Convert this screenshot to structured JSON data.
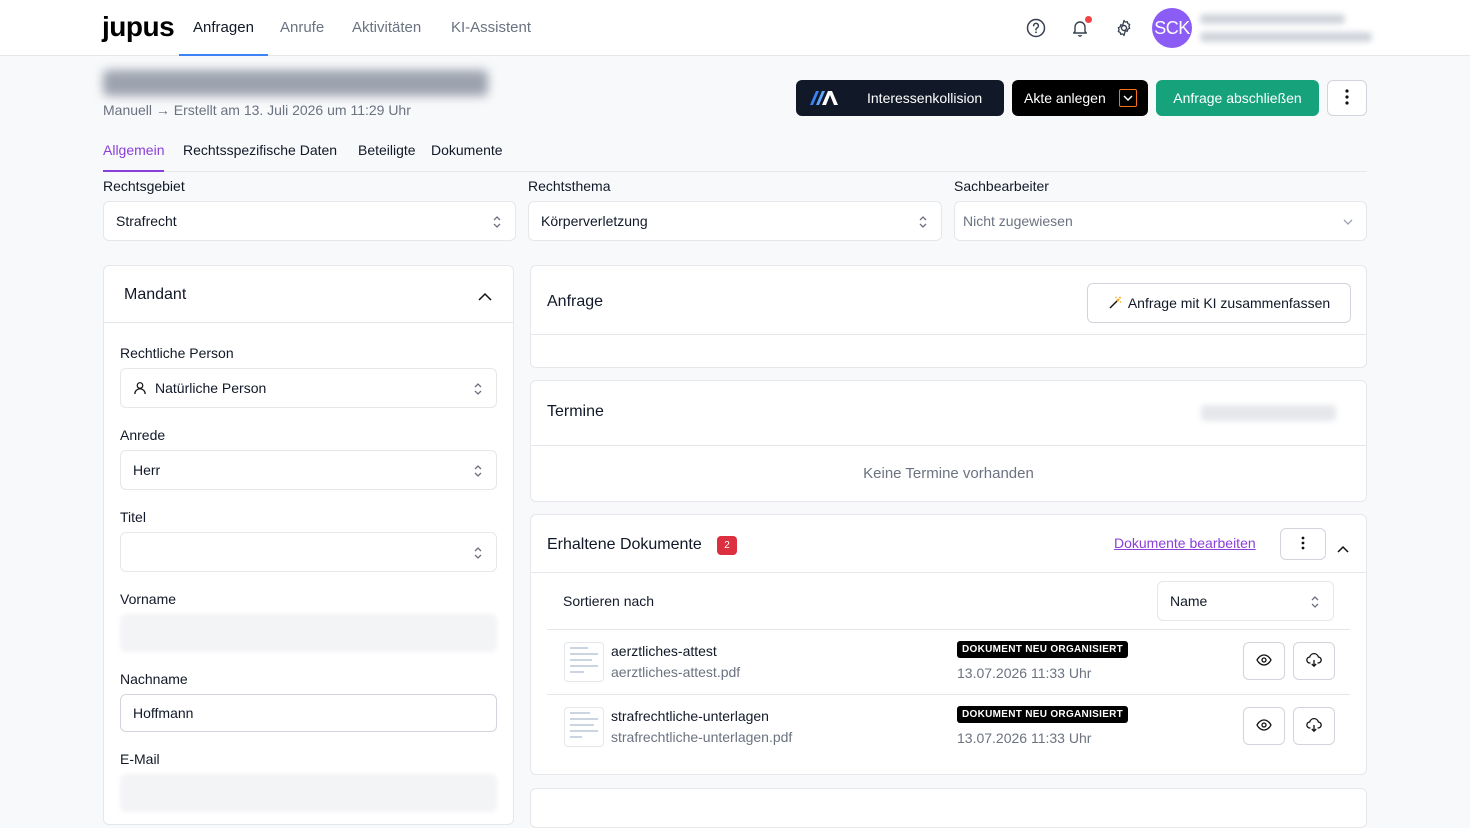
{
  "nav": {
    "logo": "jupus",
    "tabs": [
      "Anfragen",
      "Anrufe",
      "Aktivitäten",
      "KI-Assistent"
    ],
    "avatar_initials": "SCK"
  },
  "header": {
    "subtitle": "Manuell → Erstellt am 13. Juli 2026 um 11:29 Uhr",
    "btn_conflict": "Interessenkollision",
    "btn_akte": "Akte anlegen",
    "btn_close": "Anfrage abschließen"
  },
  "subtabs": [
    "Allgemein",
    "Rechtsspezifische Daten",
    "Beteiligte",
    "Dokumente"
  ],
  "fields": {
    "rechtsgebiet_label": "Rechtsgebiet",
    "rechtsgebiet_value": "Strafrecht",
    "rechtsthema_label": "Rechtsthema",
    "rechtsthema_value": "Körperverletzung",
    "sachbearbeiter_label": "Sachbearbeiter",
    "sachbearbeiter_value": "Nicht zugewiesen"
  },
  "mandant": {
    "title": "Mandant",
    "person_label": "Rechtliche Person",
    "person_value": "Natürliche Person",
    "anrede_label": "Anrede",
    "anrede_value": "Herr",
    "titel_label": "Titel",
    "titel_value": "",
    "vorname_label": "Vorname",
    "nachname_label": "Nachname",
    "nachname_value": "Hoffmann",
    "email_label": "E-Mail"
  },
  "anfrage": {
    "title": "Anfrage",
    "summarize_btn": "Anfrage mit KI zusammenfassen"
  },
  "termine": {
    "title": "Termine",
    "empty": "Keine Termine vorhanden"
  },
  "dokumente": {
    "title": "Erhaltene Dokumente",
    "count": "2",
    "edit_link": "Dokumente bearbeiten",
    "sort_label": "Sortieren nach",
    "sort_value": "Name",
    "items": [
      {
        "name": "aerztliches-attest",
        "file": "aerztliches-attest.pdf",
        "badge": "DOKUMENT NEU ORGANISIERT",
        "date": "13.07.2026 11:33 Uhr"
      },
      {
        "name": "strafrechtliche-unterlagen",
        "file": "strafrechtliche-unterlagen.pdf",
        "badge": "DOKUMENT NEU ORGANISIERT",
        "date": "13.07.2026 11:33 Uhr"
      }
    ]
  },
  "colors": {
    "accent": "#8b3fd9",
    "green": "#16a37b",
    "nav_active": "#3b82f6",
    "badge_red": "#dc2f3f"
  }
}
